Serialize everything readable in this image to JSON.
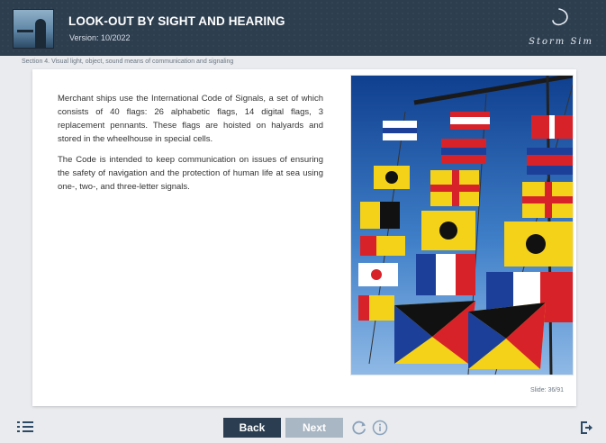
{
  "header": {
    "title": "LOOK-OUT BY SIGHT AND HEARING",
    "version": "Version: 10/2022",
    "logo_text": "Storm Sim"
  },
  "section_title": "Section 4. Visual light, object, sound means of communication and signaling",
  "content": {
    "paragraph_1": "Merchant ships use the International Code of Signals, a set of which consists of 40 flags: 26 alphabetic flags, 14 digital flags, 3 replacement pennants. These flags are hoisted on halyards and stored in the wheelhouse in special cells.",
    "paragraph_2": "The Code is intended to keep communication on issues of ensuring the safety of navigation and the protection of human life at sea using one-, two-, and three-letter signals.",
    "image_description": "signal flags photo"
  },
  "slide_counter": "Slide: 36/91",
  "nav": {
    "back_label": "Back",
    "next_label": "Next"
  },
  "icons": {
    "menu": "list-menu-icon",
    "replay": "replay-icon",
    "info": "info-icon",
    "exit": "exit-icon"
  },
  "colors": {
    "header_bg": "#2d3e4f",
    "back_button": "#2b3e51",
    "next_button_disabled": "#a9b6c3",
    "icon_blue": "#2c4a66"
  }
}
